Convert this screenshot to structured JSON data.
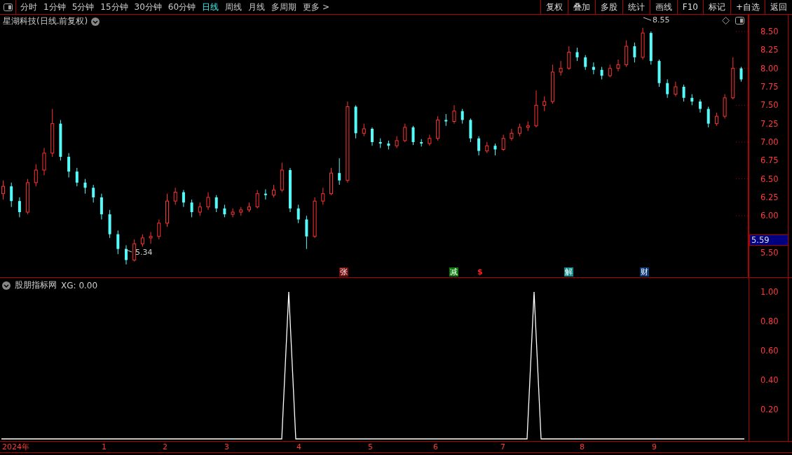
{
  "toolbar": {
    "period_tabs": [
      {
        "label": "分时",
        "selected": false
      },
      {
        "label": "1分钟",
        "selected": false
      },
      {
        "label": "5分钟",
        "selected": false
      },
      {
        "label": "15分钟",
        "selected": false
      },
      {
        "label": "30分钟",
        "selected": false
      },
      {
        "label": "60分钟",
        "selected": false
      },
      {
        "label": "日线",
        "selected": true
      },
      {
        "label": "周线",
        "selected": false
      },
      {
        "label": "月线",
        "selected": false
      },
      {
        "label": "多周期",
        "selected": false
      },
      {
        "label": "更多 >",
        "selected": false
      }
    ],
    "buttons": [
      "复权",
      "叠加",
      "多股",
      "统计",
      "画线",
      "F10",
      "标记",
      "+自选",
      "返回"
    ]
  },
  "main_chart": {
    "title": "星湖科技(日线.前复权)",
    "high_label": "8.55",
    "low_label": "5.34",
    "chart_data": {
      "type": "candlestick",
      "ylim": [
        5.167,
        8.728
      ],
      "yticks": [
        {
          "value": 8.5,
          "label": "8.50"
        },
        {
          "value": 8.25,
          "label": "8.25"
        },
        {
          "value": 8.0,
          "label": "8.00"
        },
        {
          "value": 7.75,
          "label": "7.75"
        },
        {
          "value": 7.5,
          "label": "7.50"
        },
        {
          "value": 7.25,
          "label": "7.25"
        },
        {
          "value": 7.0,
          "label": "7.00"
        },
        {
          "value": 6.75,
          "label": "6.75"
        },
        {
          "value": 6.5,
          "label": "6.50"
        },
        {
          "value": 6.25,
          "label": "6.25"
        },
        {
          "value": 6.0,
          "label": "6.00"
        },
        {
          "value": 5.5,
          "label": "5.50"
        }
      ],
      "ohlc": [
        [
          6.3,
          6.48,
          6.22,
          6.4
        ],
        [
          6.4,
          6.45,
          6.12,
          6.2
        ],
        [
          6.2,
          6.25,
          5.98,
          6.05
        ],
        [
          6.05,
          6.5,
          6.02,
          6.45
        ],
        [
          6.45,
          6.7,
          6.4,
          6.62
        ],
        [
          6.62,
          6.92,
          6.55,
          6.85
        ],
        [
          6.85,
          7.45,
          6.8,
          7.25
        ],
        [
          7.25,
          7.3,
          6.75,
          6.8
        ],
        [
          6.8,
          6.85,
          6.52,
          6.6
        ],
        [
          6.6,
          6.65,
          6.4,
          6.45
        ],
        [
          6.45,
          6.5,
          6.3,
          6.38
        ],
        [
          6.38,
          6.42,
          6.18,
          6.25
        ],
        [
          6.25,
          6.3,
          5.95,
          6.02
        ],
        [
          6.02,
          6.08,
          5.7,
          5.75
        ],
        [
          5.75,
          5.8,
          5.48,
          5.55
        ],
        [
          5.55,
          5.6,
          5.34,
          5.4
        ],
        [
          5.4,
          5.68,
          5.38,
          5.62
        ],
        [
          5.62,
          5.75,
          5.58,
          5.7
        ],
        [
          5.7,
          5.78,
          5.62,
          5.72
        ],
        [
          5.72,
          5.95,
          5.68,
          5.9
        ],
        [
          5.9,
          6.3,
          5.85,
          6.2
        ],
        [
          6.2,
          6.38,
          6.15,
          6.32
        ],
        [
          6.32,
          6.35,
          6.12,
          6.18
        ],
        [
          6.18,
          6.22,
          5.98,
          6.05
        ],
        [
          6.05,
          6.18,
          6.0,
          6.12
        ],
        [
          6.12,
          6.32,
          6.08,
          6.25
        ],
        [
          6.25,
          6.28,
          6.05,
          6.1
        ],
        [
          6.1,
          6.15,
          5.98,
          6.02
        ],
        [
          6.02,
          6.1,
          5.98,
          6.05
        ],
        [
          6.05,
          6.12,
          6.0,
          6.08
        ],
        [
          6.08,
          6.18,
          6.05,
          6.12
        ],
        [
          6.12,
          6.35,
          6.1,
          6.3
        ],
        [
          6.3,
          6.36,
          6.22,
          6.28
        ],
        [
          6.28,
          6.42,
          6.25,
          6.35
        ],
        [
          6.35,
          6.72,
          6.32,
          6.62
        ],
        [
          6.62,
          6.65,
          6.05,
          6.1
        ],
        [
          6.1,
          6.15,
          5.9,
          5.95
        ],
        [
          5.95,
          6.0,
          5.55,
          5.72
        ],
        [
          5.72,
          6.25,
          5.7,
          6.2
        ],
        [
          6.2,
          6.38,
          6.15,
          6.3
        ],
        [
          6.3,
          6.65,
          6.28,
          6.58
        ],
        [
          6.58,
          6.78,
          6.42,
          6.48
        ],
        [
          6.48,
          7.55,
          6.45,
          7.48
        ],
        [
          7.48,
          7.5,
          7.05,
          7.12
        ],
        [
          7.12,
          7.25,
          7.08,
          7.18
        ],
        [
          7.18,
          7.2,
          6.95,
          7.0
        ],
        [
          7.0,
          7.05,
          6.92,
          6.98
        ],
        [
          6.98,
          7.02,
          6.9,
          6.95
        ],
        [
          6.95,
          7.08,
          6.92,
          7.02
        ],
        [
          7.02,
          7.25,
          7.0,
          7.2
        ],
        [
          7.2,
          7.22,
          6.96,
          7.0
        ],
        [
          7.0,
          7.04,
          6.94,
          6.98
        ],
        [
          6.98,
          7.1,
          6.95,
          7.05
        ],
        [
          7.05,
          7.35,
          7.02,
          7.3
        ],
        [
          7.3,
          7.38,
          7.22,
          7.28
        ],
        [
          7.28,
          7.5,
          7.25,
          7.42
        ],
        [
          7.42,
          7.45,
          7.25,
          7.3
        ],
        [
          7.3,
          7.32,
          7.0,
          7.05
        ],
        [
          7.05,
          7.08,
          6.82,
          6.88
        ],
        [
          6.88,
          7.0,
          6.85,
          6.95
        ],
        [
          6.95,
          6.98,
          6.82,
          6.9
        ],
        [
          6.9,
          7.1,
          6.88,
          7.05
        ],
        [
          7.05,
          7.18,
          7.02,
          7.12
        ],
        [
          7.12,
          7.25,
          7.08,
          7.2
        ],
        [
          7.2,
          7.28,
          7.15,
          7.22
        ],
        [
          7.22,
          7.7,
          7.2,
          7.5
        ],
        [
          7.5,
          7.62,
          7.42,
          7.55
        ],
        [
          7.55,
          8.05,
          7.52,
          7.95
        ],
        [
          7.95,
          8.1,
          7.9,
          8.0
        ],
        [
          8.0,
          8.3,
          7.98,
          8.22
        ],
        [
          8.22,
          8.28,
          8.1,
          8.15
        ],
        [
          8.15,
          8.18,
          7.98,
          8.02
        ],
        [
          8.02,
          8.08,
          7.92,
          7.98
        ],
        [
          7.98,
          8.02,
          7.85,
          7.9
        ],
        [
          7.9,
          8.05,
          7.88,
          8.0
        ],
        [
          8.0,
          8.12,
          7.96,
          8.05
        ],
        [
          8.05,
          8.38,
          8.02,
          8.3
        ],
        [
          8.3,
          8.35,
          8.08,
          8.15
        ],
        [
          8.15,
          8.55,
          8.12,
          8.48
        ],
        [
          8.48,
          8.5,
          8.05,
          8.1
        ],
        [
          8.1,
          8.12,
          7.75,
          7.8
        ],
        [
          7.8,
          7.85,
          7.6,
          7.65
        ],
        [
          7.65,
          7.82,
          7.62,
          7.75
        ],
        [
          7.75,
          7.78,
          7.55,
          7.6
        ],
        [
          7.6,
          7.65,
          7.5,
          7.55
        ],
        [
          7.55,
          7.58,
          7.4,
          7.45
        ],
        [
          7.45,
          7.48,
          7.2,
          7.25
        ],
        [
          7.25,
          7.4,
          7.22,
          7.35
        ],
        [
          7.35,
          7.65,
          7.32,
          7.6
        ],
        [
          7.6,
          8.15,
          7.58,
          8.0
        ],
        [
          8.0,
          8.02,
          7.82,
          7.85
        ]
      ]
    },
    "current_price": "5.59",
    "markers": [
      {
        "label": "张",
        "kind": "badge",
        "color": "#7a0c0c"
      },
      {
        "label": "减",
        "kind": "badge",
        "color": "#0a7a0a"
      },
      {
        "label": "$",
        "kind": "symbol",
        "color": "#ff2020"
      },
      {
        "label": "解",
        "kind": "badge",
        "color": "#0e8a8a"
      },
      {
        "label": "财",
        "kind": "badge",
        "color": "#0c3a78"
      }
    ]
  },
  "indicator": {
    "title": "股朋指标网",
    "reading": "XG: 0.00",
    "chart_data": {
      "type": "line",
      "ylim": [
        0,
        1.1
      ],
      "yticks": [
        {
          "value": 0.2,
          "label": "0.20"
        },
        {
          "value": 0.4,
          "label": "0.40"
        },
        {
          "value": 0.6,
          "label": "0.60"
        },
        {
          "value": 0.8,
          "label": "0.80"
        },
        {
          "value": 1.0,
          "label": "1.00"
        }
      ],
      "series": [
        {
          "color": "#ffffff",
          "values": [
            0,
            0,
            0,
            0,
            0,
            0,
            0,
            0,
            0,
            0,
            0,
            0,
            0,
            0,
            0,
            0,
            0,
            0,
            0,
            0,
            0,
            0,
            0,
            0,
            0,
            0,
            0,
            0,
            0,
            0,
            0,
            0,
            0,
            0,
            0,
            0,
            0,
            0,
            0,
            0,
            0,
            1,
            0,
            0,
            0,
            0,
            0,
            0,
            0,
            0,
            0,
            0,
            0,
            0,
            0,
            0,
            0,
            0,
            0,
            0,
            0,
            0,
            0,
            0,
            0,
            0,
            0,
            0,
            0,
            0,
            0,
            0,
            0,
            0,
            0,
            0,
            1,
            0,
            0,
            0,
            0,
            0,
            0,
            0,
            0,
            0,
            0,
            0,
            0,
            0,
            0,
            0,
            0,
            0,
            0,
            0,
            0,
            0,
            0,
            0,
            0,
            0,
            0,
            0,
            0,
            0,
            0
          ]
        }
      ]
    }
  },
  "date_axis": [
    "2024年",
    "1",
    "2",
    "3",
    "4",
    "5",
    "6",
    "7",
    "8",
    "9"
  ]
}
